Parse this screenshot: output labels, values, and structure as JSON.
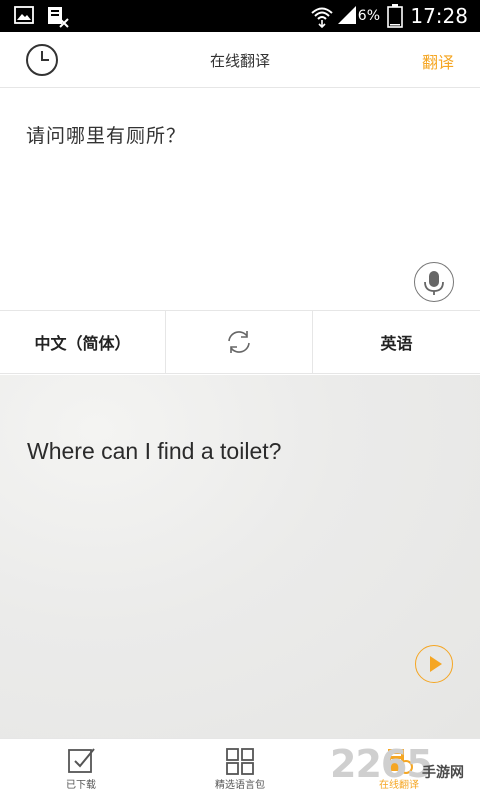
{
  "status_bar": {
    "battery_percent": "6%",
    "time": "17:28"
  },
  "header": {
    "title": "在线翻译",
    "translate_label": "翻译"
  },
  "input": {
    "source_text": "请问哪里有厕所？"
  },
  "languages": {
    "source": "中文（简体）",
    "target": "英语"
  },
  "result": {
    "translated_text": "Where can I find a toilet?"
  },
  "bottom_nav": {
    "items": [
      {
        "label": "已下载",
        "icon": "checkbox-icon"
      },
      {
        "label": "精选语言包",
        "icon": "grid-icon"
      },
      {
        "label": "在线翻译",
        "icon": "document-icon",
        "active": true
      }
    ]
  },
  "watermark": {
    "logo": "2265",
    "text": "手游网"
  },
  "colors": {
    "accent": "#f5a623",
    "status_bar": "#000000",
    "result_bg": "#ebebea"
  }
}
